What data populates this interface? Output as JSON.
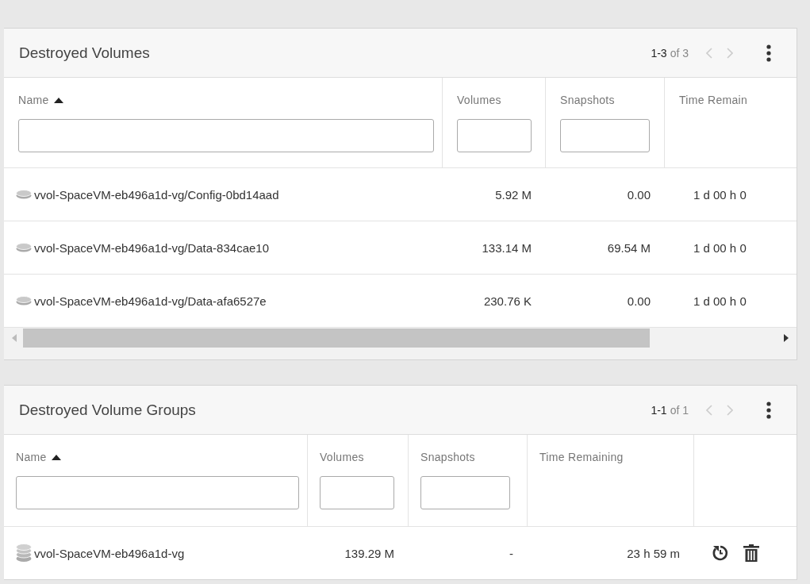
{
  "panels": [
    {
      "title": "Destroyed Volumes",
      "range": "1-3",
      "total": "of 3",
      "prev_disabled": true,
      "next_disabled": true,
      "horizontal_scroll": true,
      "columns": [
        {
          "label": "Name",
          "sorted_ascending": true,
          "filter": true
        },
        {
          "label": "Volumes",
          "filter": true
        },
        {
          "label": "Snapshots",
          "filter": true
        },
        {
          "label": "Time Remain"
        }
      ],
      "rows": [
        {
          "kind": "volume",
          "cells": [
            "vvol-SpaceVM-eb496a1d-vg/Config-0bd14aad",
            "5.92 M",
            "0.00",
            "1 d 00 h 0"
          ]
        },
        {
          "kind": "volume",
          "cells": [
            "vvol-SpaceVM-eb496a1d-vg/Data-834cae10",
            "133.14 M",
            "69.54 M",
            "1 d 00 h 0"
          ]
        },
        {
          "kind": "volume",
          "cells": [
            "vvol-SpaceVM-eb496a1d-vg/Data-afa6527e",
            "230.76 K",
            "0.00",
            "1 d 00 h 0"
          ]
        }
      ]
    },
    {
      "title": "Destroyed Volume Groups",
      "range": "1-1",
      "total": "of 1",
      "prev_disabled": true,
      "next_disabled": true,
      "actions": true,
      "columns": [
        {
          "label": "Name",
          "sorted_ascending": true,
          "filter": true
        },
        {
          "label": "Volumes",
          "filter": true
        },
        {
          "label": "Snapshots",
          "filter": true
        },
        {
          "label": "Time Remaining"
        }
      ],
      "rows": [
        {
          "kind": "volume_group",
          "cells": [
            "vvol-SpaceVM-eb496a1d-vg",
            "139.29 M",
            "-",
            "23 h 59 m"
          ]
        }
      ]
    }
  ]
}
